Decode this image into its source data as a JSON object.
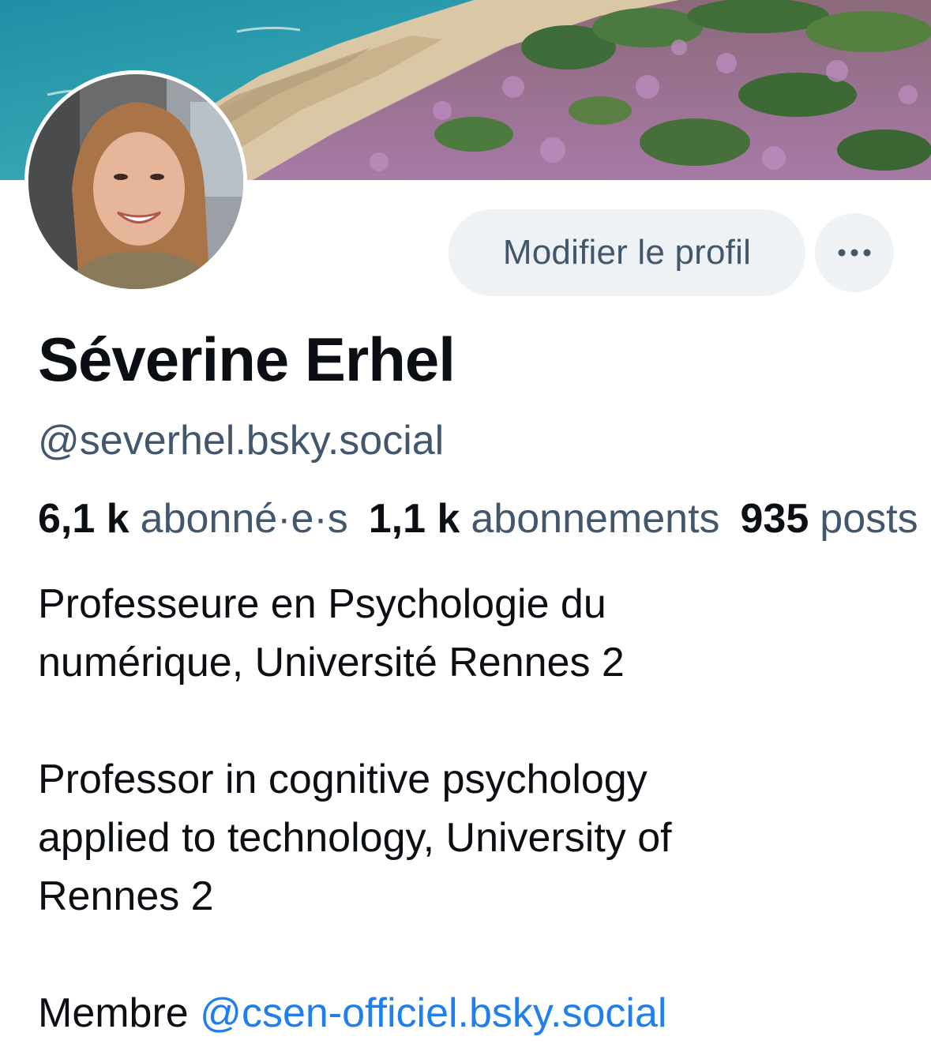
{
  "profile": {
    "display_name": "Séverine Erhel",
    "handle": "@severhel.bsky.social",
    "edit_button_label": "Modifier le profil",
    "more_button_icon": "ellipsis-icon",
    "banner_icon": "landscape-banner-image",
    "avatar_icon": "profile-photo"
  },
  "stats": {
    "followers_count": "6,1 k",
    "followers_label": "abonné·e·s",
    "following_count": "1,1 k",
    "following_label": "abonnements",
    "posts_count": "935",
    "posts_label": "posts"
  },
  "bio": {
    "line1": "Professeure en Psychologie du",
    "line2": "numérique, Université Rennes 2",
    "line3": "Professor in cognitive psychology",
    "line4": "applied to technology, University of",
    "line5": "Rennes 2",
    "member_prefix": "Membre ",
    "member_mention": "@csen-officiel.bsky.social"
  },
  "colors": {
    "text_primary": "#0b0f14",
    "text_secondary": "#42576c",
    "link": "#1f7fef",
    "button_bg": "#eef2f5"
  }
}
